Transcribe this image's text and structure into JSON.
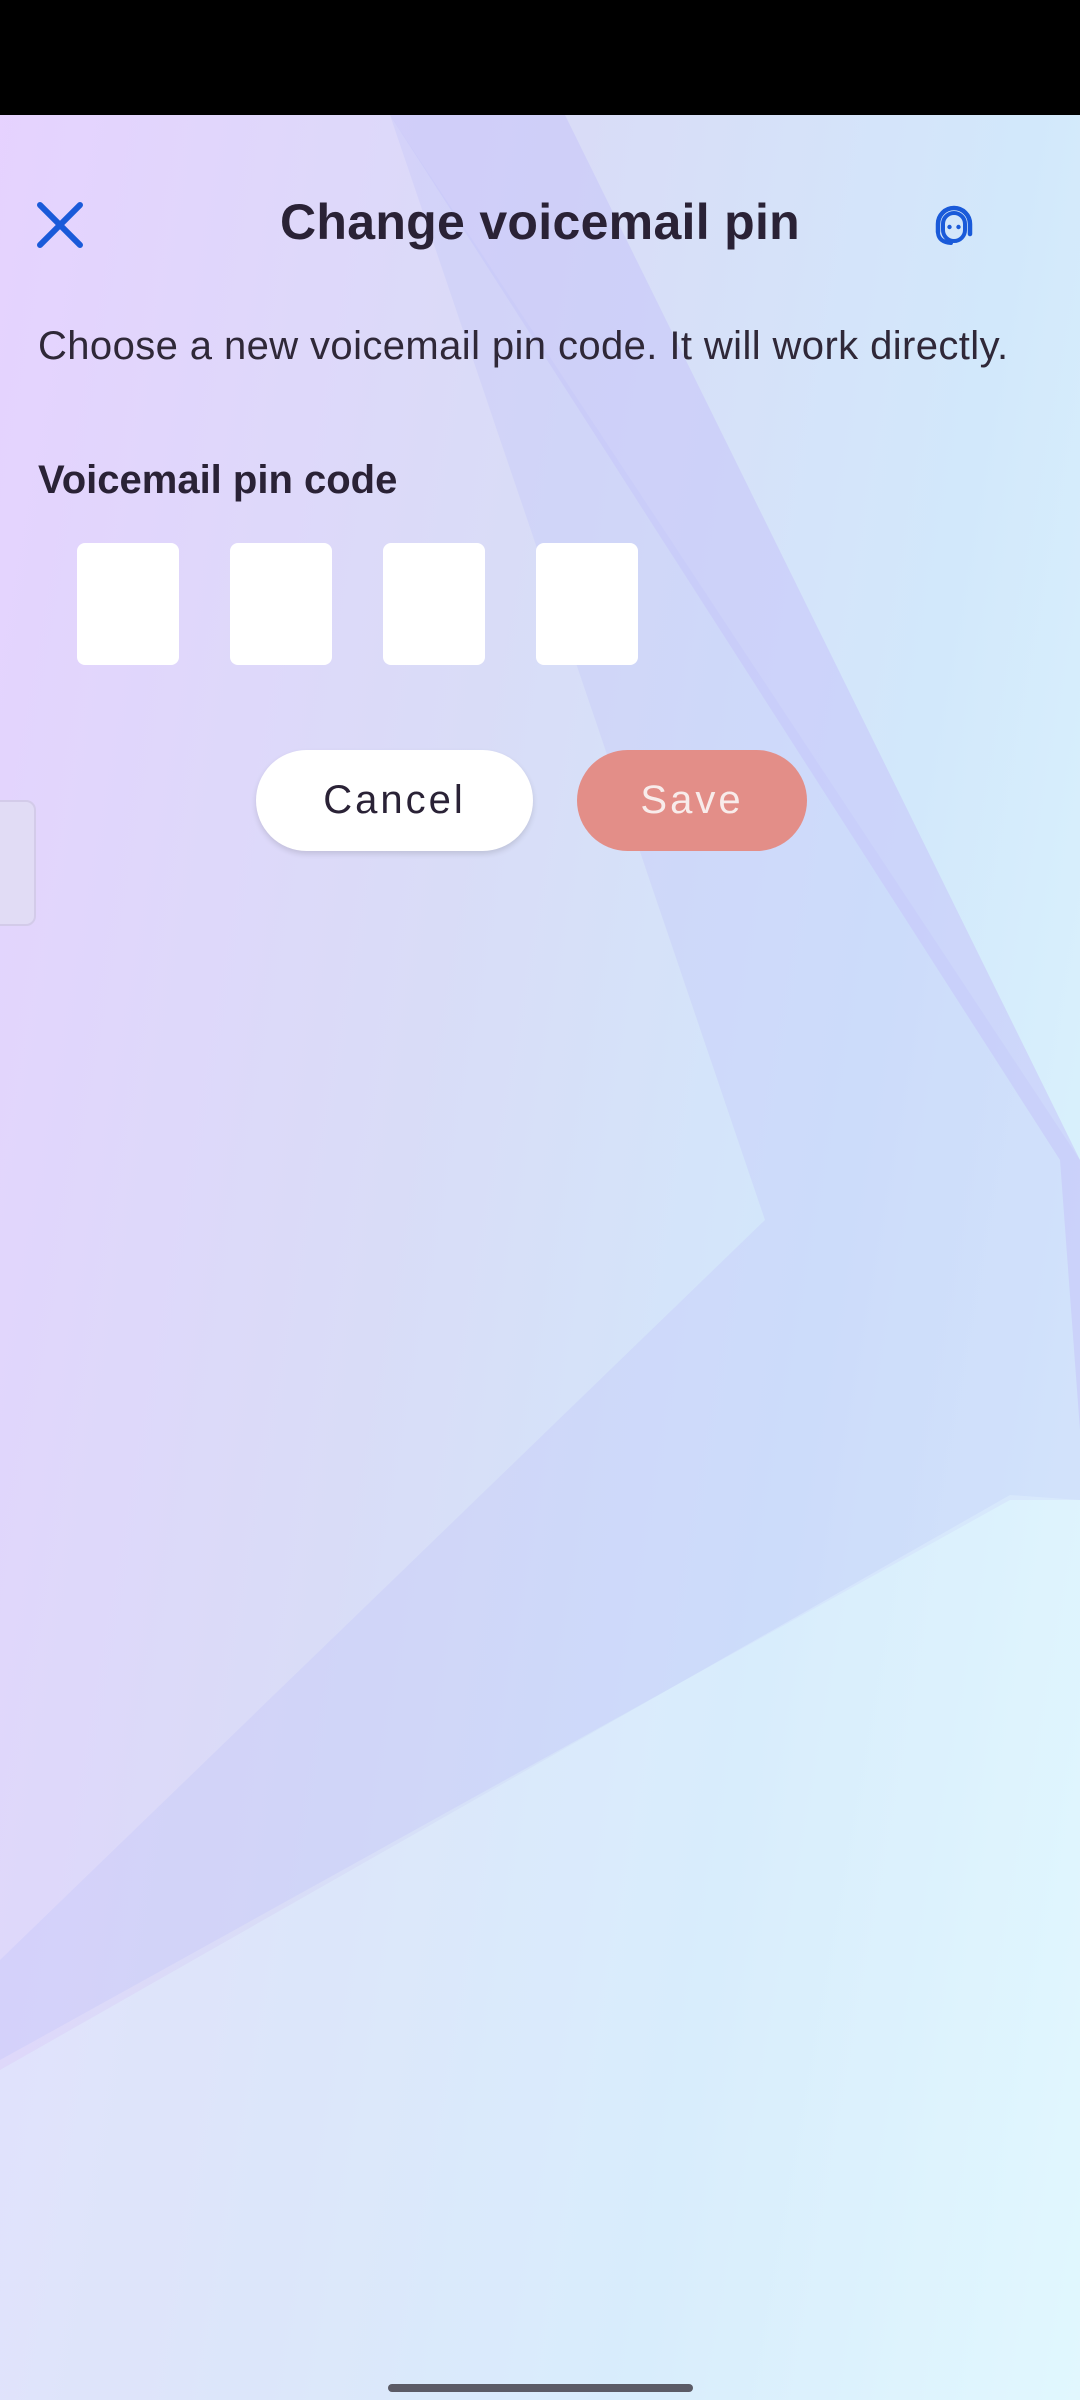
{
  "header": {
    "title": "Change voicemail pin",
    "close_icon": "close-icon",
    "support_icon": "headset-support-icon"
  },
  "content": {
    "description": "Choose a new voicemail pin code. It will work directly.",
    "pin_label": "Voicemail pin code",
    "pin_digits": [
      "",
      "",
      "",
      ""
    ]
  },
  "actions": {
    "cancel_label": "Cancel",
    "save_label": "Save"
  },
  "colors": {
    "accent": "#1a5ad9",
    "save_button": "#e38e88",
    "title_text": "#2a2236"
  }
}
